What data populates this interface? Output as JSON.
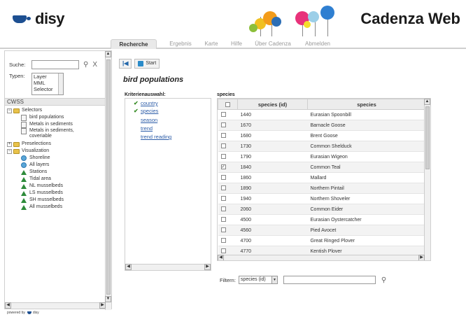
{
  "brand": {
    "logo_text": "disy",
    "app_title": "Cadenza Web",
    "powered_by": "powered by",
    "powered_brand": "disy"
  },
  "tabs": [
    "Recherche",
    "Ergebnis",
    "Karte",
    "Hilfe",
    "Über Cadenza",
    "Abmelden"
  ],
  "sidebar": {
    "search_label": "Suche:",
    "search_value": "",
    "clear_label": "X",
    "types_label": "Typen:",
    "types_options": [
      "Layer",
      "MML",
      "Selector"
    ],
    "section": "CWSS",
    "tree": {
      "selectors": "Selectors",
      "selector_items": [
        "bird populations",
        "Metals in sediments",
        "Metals in sediments, coveriable"
      ],
      "preselections": "Preselections",
      "visualization": "Visualization",
      "visualization_items": [
        "Shoreline",
        "All layers",
        "Stations",
        "Tidal area",
        "NL musselbeds",
        "LS musselbeds",
        "SH musselbeds",
        "All musselbeds"
      ]
    }
  },
  "toolbar": {
    "start_label": "Start"
  },
  "query": {
    "title": "bird populations",
    "criteria_label": "Kriterienauswahl:",
    "criteria": [
      "country",
      "species",
      "season",
      "trend",
      "trend reading"
    ],
    "species_label": "species"
  },
  "table": {
    "headers": [
      "species (id)",
      "species"
    ],
    "rows": [
      [
        "1440",
        "Eurasian Spoonbill"
      ],
      [
        "1670",
        "Barnacle Goose"
      ],
      [
        "1680",
        "Brent Goose"
      ],
      [
        "1730",
        "Common Shelduck"
      ],
      [
        "1790",
        "Eurasian Wigeon"
      ],
      [
        "1840",
        "Common Teal"
      ],
      [
        "1860",
        "Mallard"
      ],
      [
        "1890",
        "Northern Pintail"
      ],
      [
        "1940",
        "Northern Shoveler"
      ],
      [
        "2060",
        "Common Eider"
      ],
      [
        "4500",
        "Eurasian Oystercatcher"
      ],
      [
        "4560",
        "Pied Avocet"
      ],
      [
        "4700",
        "Great Ringed Plover"
      ],
      [
        "4770",
        "Kentish Plover"
      ]
    ],
    "checked_row": 5
  },
  "filter": {
    "label": "Filtern:",
    "selected": "species (id)",
    "value": ""
  },
  "colors": {
    "brand_blue": "#1d4f91",
    "link_blue": "#2d5da8",
    "tree_green": "#2e8b3a"
  }
}
